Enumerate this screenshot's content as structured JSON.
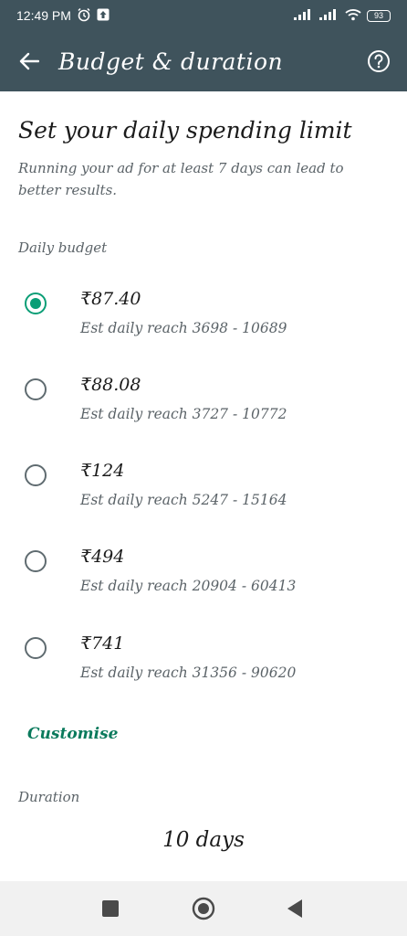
{
  "status_bar": {
    "time": "12:49 PM",
    "battery": "93"
  },
  "app_bar": {
    "title": "Budget & duration"
  },
  "page": {
    "heading": "Set your daily spending limit",
    "subtext": "Running your ad for at least 7 days can lead to better results."
  },
  "daily_budget": {
    "label": "Daily budget",
    "selected_index": 0,
    "options": [
      {
        "amount": "₹87.40",
        "reach": "Est daily reach 3698 - 10689"
      },
      {
        "amount": "₹88.08",
        "reach": "Est daily reach 3727 - 10772"
      },
      {
        "amount": "₹124",
        "reach": "Est daily reach 5247 - 15164"
      },
      {
        "amount": "₹494",
        "reach": "Est daily reach 20904 - 60413"
      },
      {
        "amount": "₹741",
        "reach": "Est daily reach 31356 - 90620"
      }
    ],
    "customise_label": "Customise"
  },
  "duration": {
    "label": "Duration",
    "value": "10 days"
  },
  "colors": {
    "header_bg": "#3f535c",
    "accent": "#0a9e76"
  }
}
